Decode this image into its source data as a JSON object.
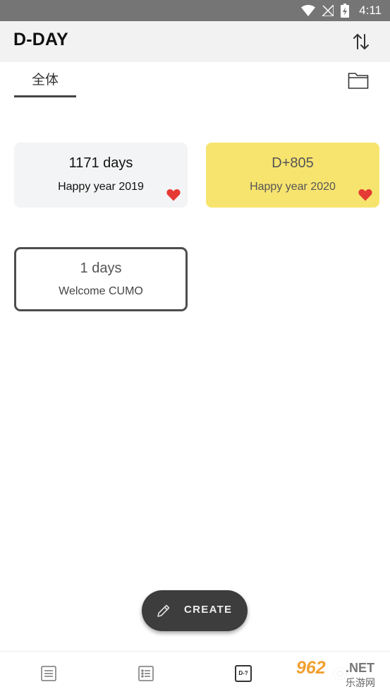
{
  "status_bar": {
    "time": "4:11"
  },
  "app_bar": {
    "title": "D-DAY"
  },
  "tabs": [
    {
      "label": "全体",
      "selected": true
    }
  ],
  "cards": [
    {
      "title": "1171 days",
      "subtitle": "Happy year 2019",
      "favorite": true,
      "background": "#f3f4f5"
    },
    {
      "title": "D+805",
      "subtitle": "Happy year 2020",
      "favorite": true,
      "background": "#f7e46f"
    },
    {
      "title": "1 days",
      "subtitle": "Welcome CUMO",
      "favorite": false,
      "background": "#ffffff"
    }
  ],
  "fab": {
    "label": "CREATE"
  },
  "bottom_nav": {
    "items": [
      "memo-icon",
      "list-icon",
      "dday-icon",
      "settings-icon"
    ],
    "dday_icon_text": "D-?"
  },
  "watermark": {
    "number": "962",
    "domain": ".NET",
    "name": "乐游网"
  },
  "colors": {
    "heart": "#e53935",
    "fab": "#3d3d3d",
    "highlight_card": "#f7e46f"
  }
}
